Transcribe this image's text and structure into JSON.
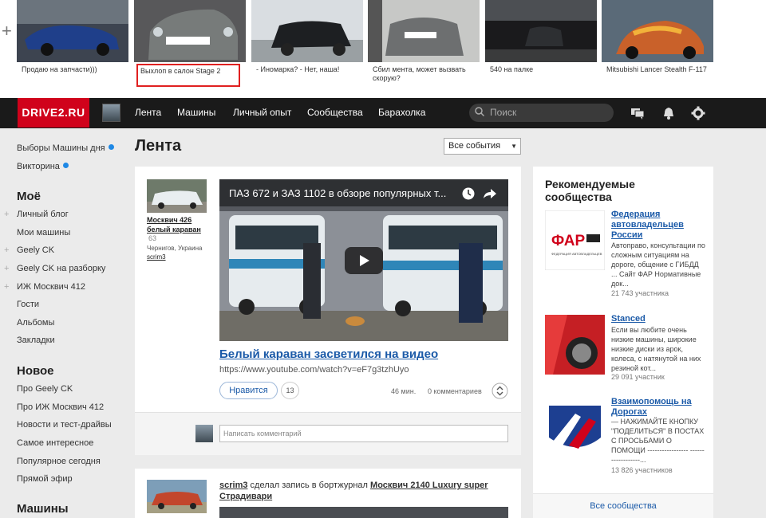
{
  "carousel": {
    "items": [
      {
        "caption": "Продаю на запчасти)))"
      },
      {
        "caption": "Выхлоп в салон Stage 2"
      },
      {
        "caption": "- Иномарка? - Нет, наша!"
      },
      {
        "caption": "Сбил мента, может вызвать скорую?"
      },
      {
        "caption": "540 на палке"
      },
      {
        "caption": "Mitsubishi Lancer Stealth F-117"
      }
    ]
  },
  "nav": {
    "logo": "DRIVE2.RU",
    "items": [
      "Лента",
      "Машины",
      "Личный опыт",
      "Сообщества",
      "Барахолка"
    ],
    "search_placeholder": "Поиск"
  },
  "sidebar": {
    "top": [
      {
        "label": "Выборы Машины дня"
      },
      {
        "label": "Викторина"
      }
    ],
    "mine_head": "Моё",
    "mine": [
      {
        "label": "Личный блог"
      },
      {
        "label": "Мои машины"
      },
      {
        "label": "Geely CK"
      },
      {
        "label": "Geely CK на разборку"
      },
      {
        "label": "ИЖ Москвич 412"
      },
      {
        "label": "Гости"
      },
      {
        "label": "Альбомы"
      },
      {
        "label": "Закладки"
      }
    ],
    "new_head": "Новое",
    "new": [
      {
        "label": "Про Geely CK"
      },
      {
        "label": "Про ИЖ Москвич 412"
      },
      {
        "label": "Новости и тест-драйвы"
      },
      {
        "label": "Самое интересное"
      },
      {
        "label": "Популярное сегодня"
      },
      {
        "label": "Прямой эфир"
      }
    ],
    "cars_head": "Машины"
  },
  "main": {
    "title": "Лента",
    "filter": "Все события",
    "post": {
      "car_name": "Москвич 426 белый караван",
      "car_year": "63",
      "location": "Чернигов, Украина",
      "author": "scrim3",
      "video_title": "ПАЗ 672 и ЗАЗ 1102 в обзоре популярных т...",
      "link_title": "Белый караван засветился на видео",
      "url": "https://www.youtube.com/watch?v=eF7g3tzhUyo",
      "like_label": "Нравится",
      "likes": "13",
      "time": "46 мин.",
      "comments": "0 комментариев",
      "comment_placeholder": "Написать комментарий"
    },
    "post2": {
      "author": "scrim3",
      "action": "сделал запись в бортжурнал",
      "car": "Москвич 2140 Luxury super Страдивари"
    }
  },
  "recommended": {
    "title": "Рекомендуемые сообщества",
    "items": [
      {
        "name": "Федерация автовладельцев России",
        "desc": "Автоправо, консультации по сложным ситуациям на дороге, общение с ГИБДД ... Сайт ФАР Нормативные док...",
        "count": "21 743 участника"
      },
      {
        "name": "Stanced",
        "desc": "Если вы любите очень низкие машины, широкие низкие диски из арок, колеса, с натянутой на них резиной кот...",
        "count": "29 091 участник"
      },
      {
        "name": "Взаимопомощь на Дорогах",
        "desc": "— НАЖИМАЙТЕ КНОПКУ \"ПОДЕЛИТЬСЯ\" В ПОСТАХ С ПРОСЬБАМИ О ПОМОЩИ ----------------- ------------------...",
        "count": "13 826 участников"
      }
    ],
    "footer": "Все сообщества"
  }
}
